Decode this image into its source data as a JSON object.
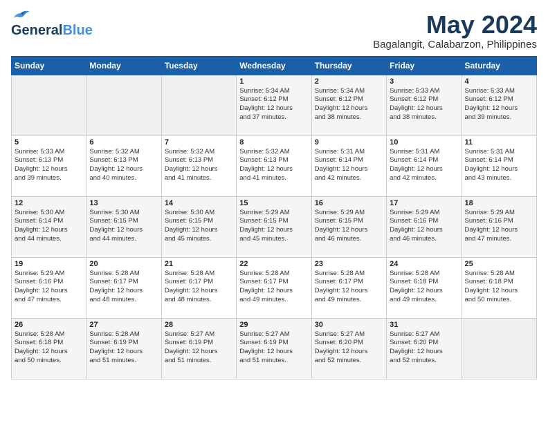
{
  "header": {
    "logo_general": "General",
    "logo_blue": "Blue",
    "month": "May 2024",
    "location": "Bagalangit, Calabarzon, Philippines"
  },
  "weekdays": [
    "Sunday",
    "Monday",
    "Tuesday",
    "Wednesday",
    "Thursday",
    "Friday",
    "Saturday"
  ],
  "weeks": [
    [
      {
        "day": "",
        "info": ""
      },
      {
        "day": "",
        "info": ""
      },
      {
        "day": "",
        "info": ""
      },
      {
        "day": "1",
        "info": "Sunrise: 5:34 AM\nSunset: 6:12 PM\nDaylight: 12 hours\nand 37 minutes."
      },
      {
        "day": "2",
        "info": "Sunrise: 5:34 AM\nSunset: 6:12 PM\nDaylight: 12 hours\nand 38 minutes."
      },
      {
        "day": "3",
        "info": "Sunrise: 5:33 AM\nSunset: 6:12 PM\nDaylight: 12 hours\nand 38 minutes."
      },
      {
        "day": "4",
        "info": "Sunrise: 5:33 AM\nSunset: 6:12 PM\nDaylight: 12 hours\nand 39 minutes."
      }
    ],
    [
      {
        "day": "5",
        "info": "Sunrise: 5:33 AM\nSunset: 6:13 PM\nDaylight: 12 hours\nand 39 minutes."
      },
      {
        "day": "6",
        "info": "Sunrise: 5:32 AM\nSunset: 6:13 PM\nDaylight: 12 hours\nand 40 minutes."
      },
      {
        "day": "7",
        "info": "Sunrise: 5:32 AM\nSunset: 6:13 PM\nDaylight: 12 hours\nand 41 minutes."
      },
      {
        "day": "8",
        "info": "Sunrise: 5:32 AM\nSunset: 6:13 PM\nDaylight: 12 hours\nand 41 minutes."
      },
      {
        "day": "9",
        "info": "Sunrise: 5:31 AM\nSunset: 6:14 PM\nDaylight: 12 hours\nand 42 minutes."
      },
      {
        "day": "10",
        "info": "Sunrise: 5:31 AM\nSunset: 6:14 PM\nDaylight: 12 hours\nand 42 minutes."
      },
      {
        "day": "11",
        "info": "Sunrise: 5:31 AM\nSunset: 6:14 PM\nDaylight: 12 hours\nand 43 minutes."
      }
    ],
    [
      {
        "day": "12",
        "info": "Sunrise: 5:30 AM\nSunset: 6:14 PM\nDaylight: 12 hours\nand 44 minutes."
      },
      {
        "day": "13",
        "info": "Sunrise: 5:30 AM\nSunset: 6:15 PM\nDaylight: 12 hours\nand 44 minutes."
      },
      {
        "day": "14",
        "info": "Sunrise: 5:30 AM\nSunset: 6:15 PM\nDaylight: 12 hours\nand 45 minutes."
      },
      {
        "day": "15",
        "info": "Sunrise: 5:29 AM\nSunset: 6:15 PM\nDaylight: 12 hours\nand 45 minutes."
      },
      {
        "day": "16",
        "info": "Sunrise: 5:29 AM\nSunset: 6:15 PM\nDaylight: 12 hours\nand 46 minutes."
      },
      {
        "day": "17",
        "info": "Sunrise: 5:29 AM\nSunset: 6:16 PM\nDaylight: 12 hours\nand 46 minutes."
      },
      {
        "day": "18",
        "info": "Sunrise: 5:29 AM\nSunset: 6:16 PM\nDaylight: 12 hours\nand 47 minutes."
      }
    ],
    [
      {
        "day": "19",
        "info": "Sunrise: 5:29 AM\nSunset: 6:16 PM\nDaylight: 12 hours\nand 47 minutes."
      },
      {
        "day": "20",
        "info": "Sunrise: 5:28 AM\nSunset: 6:17 PM\nDaylight: 12 hours\nand 48 minutes."
      },
      {
        "day": "21",
        "info": "Sunrise: 5:28 AM\nSunset: 6:17 PM\nDaylight: 12 hours\nand 48 minutes."
      },
      {
        "day": "22",
        "info": "Sunrise: 5:28 AM\nSunset: 6:17 PM\nDaylight: 12 hours\nand 49 minutes."
      },
      {
        "day": "23",
        "info": "Sunrise: 5:28 AM\nSunset: 6:17 PM\nDaylight: 12 hours\nand 49 minutes."
      },
      {
        "day": "24",
        "info": "Sunrise: 5:28 AM\nSunset: 6:18 PM\nDaylight: 12 hours\nand 49 minutes."
      },
      {
        "day": "25",
        "info": "Sunrise: 5:28 AM\nSunset: 6:18 PM\nDaylight: 12 hours\nand 50 minutes."
      }
    ],
    [
      {
        "day": "26",
        "info": "Sunrise: 5:28 AM\nSunset: 6:18 PM\nDaylight: 12 hours\nand 50 minutes."
      },
      {
        "day": "27",
        "info": "Sunrise: 5:28 AM\nSunset: 6:19 PM\nDaylight: 12 hours\nand 51 minutes."
      },
      {
        "day": "28",
        "info": "Sunrise: 5:27 AM\nSunset: 6:19 PM\nDaylight: 12 hours\nand 51 minutes."
      },
      {
        "day": "29",
        "info": "Sunrise: 5:27 AM\nSunset: 6:19 PM\nDaylight: 12 hours\nand 51 minutes."
      },
      {
        "day": "30",
        "info": "Sunrise: 5:27 AM\nSunset: 6:20 PM\nDaylight: 12 hours\nand 52 minutes."
      },
      {
        "day": "31",
        "info": "Sunrise: 5:27 AM\nSunset: 6:20 PM\nDaylight: 12 hours\nand 52 minutes."
      },
      {
        "day": "",
        "info": ""
      }
    ]
  ]
}
